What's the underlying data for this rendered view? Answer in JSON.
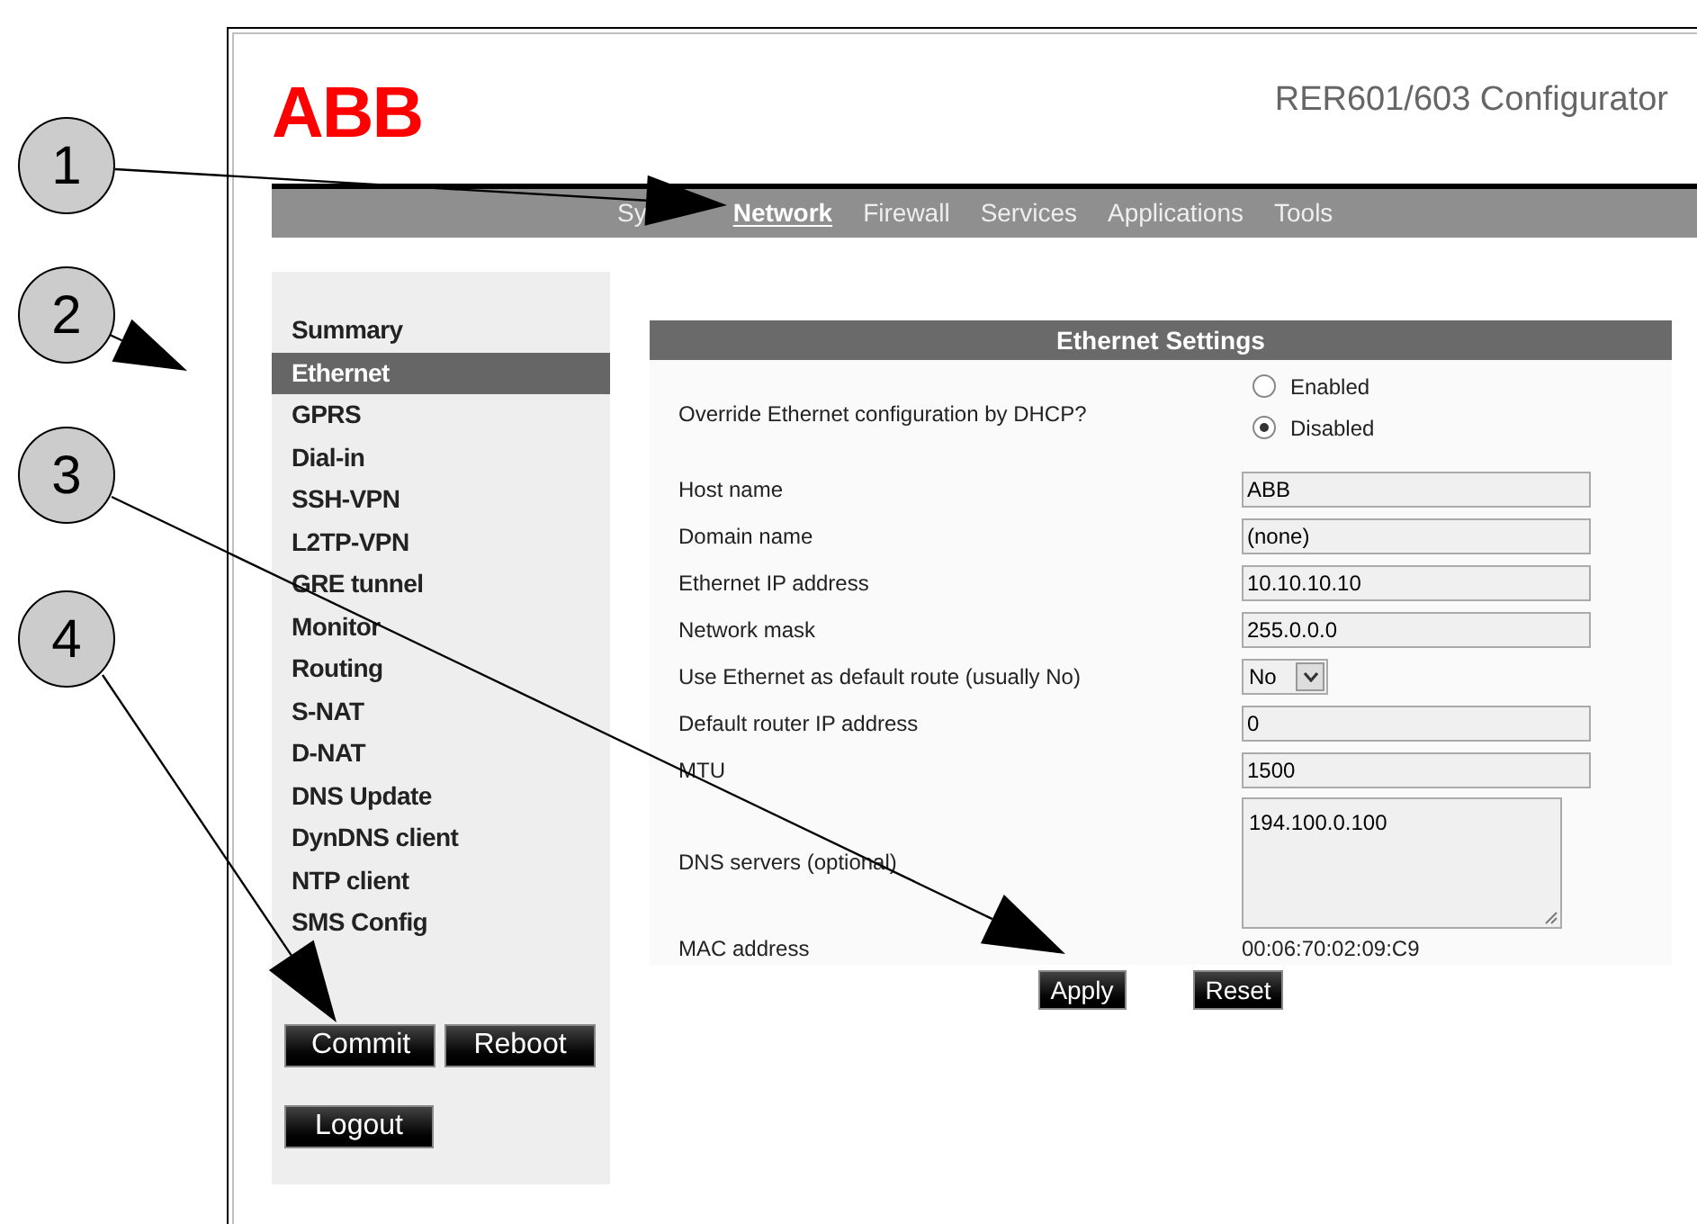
{
  "callouts": [
    {
      "number": "1"
    },
    {
      "number": "2"
    },
    {
      "number": "3"
    },
    {
      "number": "4"
    }
  ],
  "header": {
    "logo": "ABB",
    "title": "RER601/603 Configurator"
  },
  "nav": [
    {
      "label": "Sy",
      "selected": false
    },
    {
      "label": "Network",
      "selected": true
    },
    {
      "label": "Firewall",
      "selected": false
    },
    {
      "label": "Services",
      "selected": false
    },
    {
      "label": "Applications",
      "selected": false
    },
    {
      "label": "Tools",
      "selected": false
    }
  ],
  "sidebar": {
    "items": [
      {
        "label": "Summary",
        "selected": false
      },
      {
        "label": "Ethernet",
        "selected": true
      },
      {
        "label": "GPRS",
        "selected": false
      },
      {
        "label": "Dial-in",
        "selected": false
      },
      {
        "label": "SSH-VPN",
        "selected": false
      },
      {
        "label": "L2TP-VPN",
        "selected": false
      },
      {
        "label": "GRE tunnel",
        "selected": false
      },
      {
        "label": "Monitor",
        "selected": false
      },
      {
        "label": "Routing",
        "selected": false
      },
      {
        "label": "S-NAT",
        "selected": false
      },
      {
        "label": "D-NAT",
        "selected": false
      },
      {
        "label": "DNS Update",
        "selected": false
      },
      {
        "label": "DynDNS client",
        "selected": false
      },
      {
        "label": "NTP client",
        "selected": false
      },
      {
        "label": "SMS Config",
        "selected": false
      }
    ],
    "buttons": [
      "Commit",
      "Reboot",
      "Logout"
    ]
  },
  "panel": {
    "title": "Ethernet Settings",
    "fields": [
      {
        "kind": "radio",
        "label": "Override Ethernet configuration by DHCP?",
        "options": [
          {
            "label": "Enabled",
            "selected": false
          },
          {
            "label": "Disabled",
            "selected": true
          }
        ]
      },
      {
        "kind": "text",
        "label": "Host name",
        "value": "ABB"
      },
      {
        "kind": "text",
        "label": "Domain name",
        "value": "(none)"
      },
      {
        "kind": "text",
        "label": "Ethernet IP address",
        "value": "10.10.10.10"
      },
      {
        "kind": "text",
        "label": "Network mask",
        "value": "255.0.0.0"
      },
      {
        "kind": "select",
        "label": "Use Ethernet as default route (usually No)",
        "value": "No"
      },
      {
        "kind": "text",
        "label": "Default router IP address",
        "value": "0"
      },
      {
        "kind": "text",
        "label": "MTU",
        "value": "1500"
      },
      {
        "kind": "textarea",
        "label": "DNS servers (optional)",
        "value": "194.100.0.100"
      },
      {
        "kind": "static",
        "label": "MAC address",
        "value": "00:06:70:02:09:C9"
      }
    ],
    "buttons": [
      "Apply",
      "Reset"
    ]
  }
}
